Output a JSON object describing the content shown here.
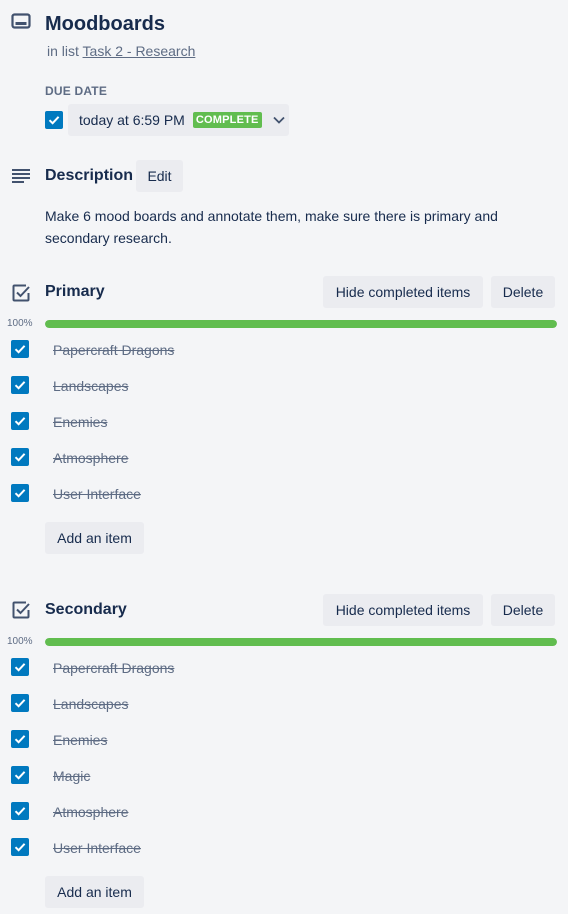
{
  "card": {
    "title": "Moodboards",
    "in_list_prefix": "in list",
    "list_name": "Task 2 - Research"
  },
  "due": {
    "label": "DUE DATE",
    "checked": true,
    "datetime": "today at 6:59 PM",
    "status": "COMPLETE"
  },
  "description": {
    "title": "Description",
    "edit_label": "Edit",
    "text": "Make 6 mood boards and annotate them, make sure there is primary and secondary research."
  },
  "checklists": [
    {
      "title": "Primary",
      "hide_label": "Hide completed items",
      "delete_label": "Delete",
      "progress_label": "100%",
      "progress": 1.0,
      "add_label": "Add an item",
      "items": [
        {
          "text": "Papercraft Dragons",
          "checked": true
        },
        {
          "text": "Landscapes",
          "checked": true
        },
        {
          "text": "Enemies",
          "checked": true
        },
        {
          "text": "Atmosphere",
          "checked": true
        },
        {
          "text": "User Interface",
          "checked": true
        }
      ]
    },
    {
      "title": "Secondary",
      "hide_label": "Hide completed items",
      "delete_label": "Delete",
      "progress_label": "100%",
      "progress": 1.0,
      "add_label": "Add an item",
      "items": [
        {
          "text": "Papercraft Dragons",
          "checked": true
        },
        {
          "text": "Landscapes",
          "checked": true
        },
        {
          "text": "Enemies",
          "checked": true
        },
        {
          "text": "Magic",
          "checked": true
        },
        {
          "text": "Atmosphere",
          "checked": true
        },
        {
          "text": "User Interface",
          "checked": true
        }
      ]
    }
  ],
  "colors": {
    "accent": "#0079bf",
    "complete": "#61bd4f",
    "text": "#172b4d",
    "muted": "#5e6c84",
    "button_bg": "#ebecf0",
    "background": "#f4f5f7"
  },
  "icons": {
    "header": "card-icon",
    "description": "description-icon",
    "checklist": "checklist-icon",
    "checkbox": "checkmark-icon",
    "dropdown": "chevron-down-icon"
  }
}
